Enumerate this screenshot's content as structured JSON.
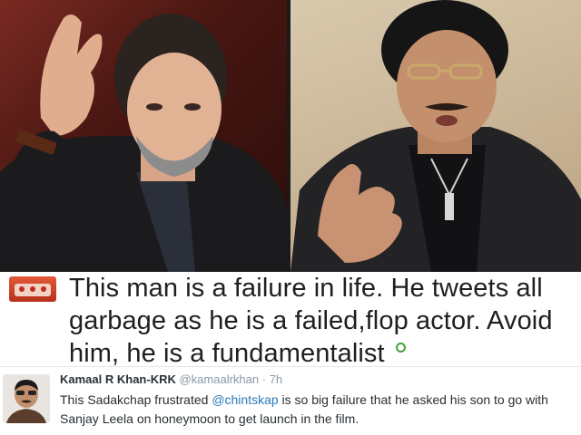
{
  "tweet_main": {
    "text": "This man is a failure in life. He tweets all garbage as he is a failed,flop actor. Avoid him, he is a fundamentalist"
  },
  "tweet_reply": {
    "name": "Kamaal R Khan-KRK",
    "handle": "@kamaalrkhan",
    "separator": "·",
    "time": "7h",
    "text_before": "This Sadakchap frustrated ",
    "mention": "@chintskap",
    "text_after": " is so big failure that he asked his son to go with Sanjay Leela on honeymoon to get launch in the film."
  },
  "colors": {
    "mention": "#2b7bb9",
    "meta": "#8899a6",
    "online_dot": "#3fa33a"
  }
}
